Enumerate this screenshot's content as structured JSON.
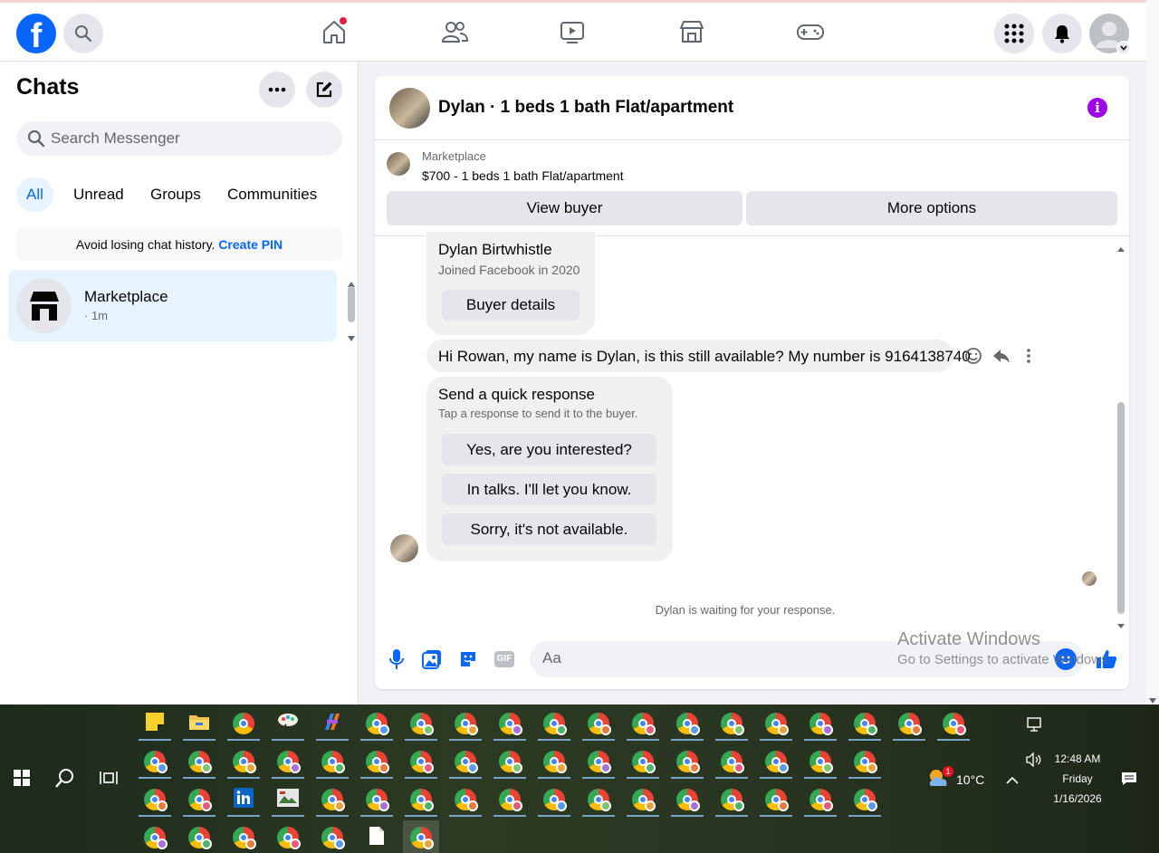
{
  "topbar": {
    "logo": "f",
    "nav_icons": [
      "home-icon",
      "friends-icon",
      "video-icon",
      "marketplace-icon",
      "gaming-icon"
    ]
  },
  "chats": {
    "title": "Chats",
    "search_placeholder": "Search Messenger",
    "filters": [
      "All",
      "Unread",
      "Groups",
      "Communities"
    ],
    "pin_banner_text": "Avoid losing chat history.",
    "pin_link": "Create PIN",
    "items": [
      {
        "name": "Marketplace",
        "time": "· 1m"
      }
    ]
  },
  "conversation": {
    "title": "Dylan · 1 beds 1 bath Flat/apartment",
    "listing_source": "Marketplace",
    "listing_desc": "$700 - 1 beds 1 bath Flat/apartment",
    "view_buyer": "View buyer",
    "more_options": "More options",
    "buyer_card": {
      "name": "Dylan Birtwhistle",
      "joined": "Joined Facebook in 2020",
      "button": "Buyer details"
    },
    "message": "Hi Rowan, my name is Dylan, is this still available? My number is 9164138740",
    "quick_response": {
      "title": "Send a quick response",
      "subtitle": "Tap a response to send it to the buyer.",
      "options": [
        "Yes, are you interested?",
        "In talks. I'll let you know.",
        "Sorry, it's not available."
      ]
    },
    "waiting": "Dylan is waiting for your response.",
    "composer_placeholder": "Aa",
    "gif_label": "GIF"
  },
  "watermark": {
    "line1": "Activate Windows",
    "line2": "Go to Settings to activate Windows."
  },
  "taskbar": {
    "weather": "10°C",
    "time": "12:48 AM",
    "day": "Friday",
    "date": "1/16/2026",
    "weather_badge": "1"
  },
  "colors": {
    "brand": "#0866ff",
    "info": "#a000e8",
    "active_bg": "#e7f3ff"
  }
}
